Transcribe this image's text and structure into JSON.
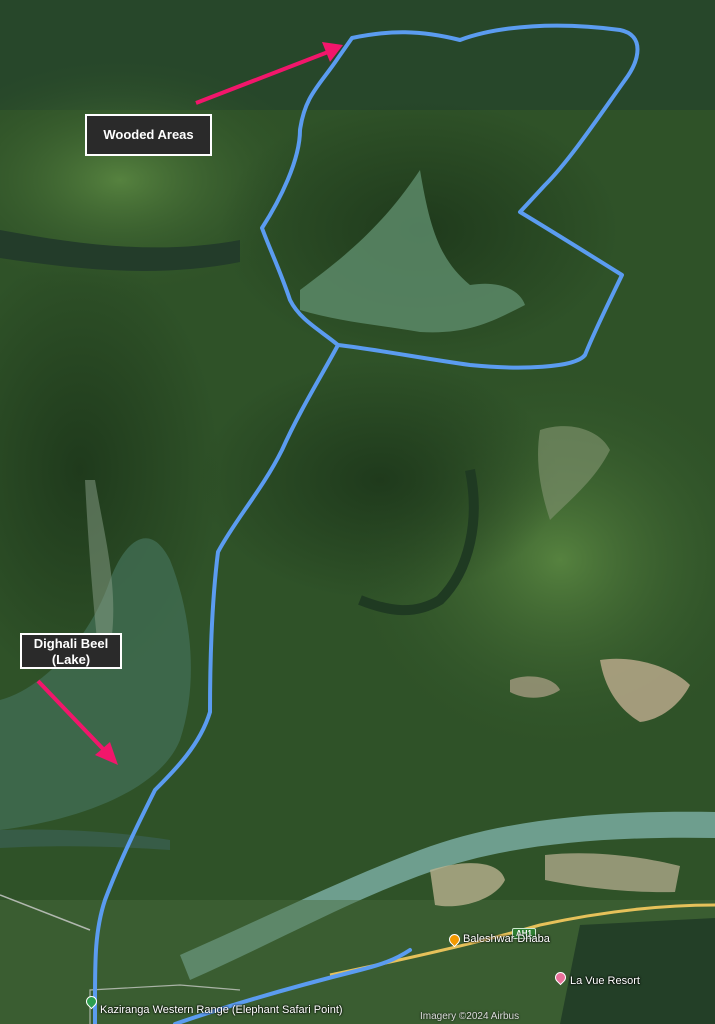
{
  "callouts": {
    "wooded": {
      "text": "Wooded Areas"
    },
    "lake": {
      "line1": "Dighali Beel",
      "line2": "(Lake)"
    }
  },
  "places": {
    "dhaba": {
      "label": "Baleshwar Dhaba",
      "icon": "restaurant-pin-icon",
      "color": "#f29900"
    },
    "resort": {
      "label": "La Vue Resort",
      "icon": "hotel-pin-icon",
      "color": "#e8719a"
    },
    "range": {
      "label": "Kaziranga Western Range (Elephant Safari Point)",
      "icon": "park-pin-icon",
      "color": "#2e9e4f"
    }
  },
  "highway": {
    "label": "AH1"
  },
  "copyright": {
    "text": "Imagery ©2024 Airbus"
  },
  "colors": {
    "route": "#5b9cf0",
    "arrow": "#f2166b",
    "river": "#6e9e8e",
    "forest": "#2f5228",
    "grassland": "#4f7a3e"
  }
}
